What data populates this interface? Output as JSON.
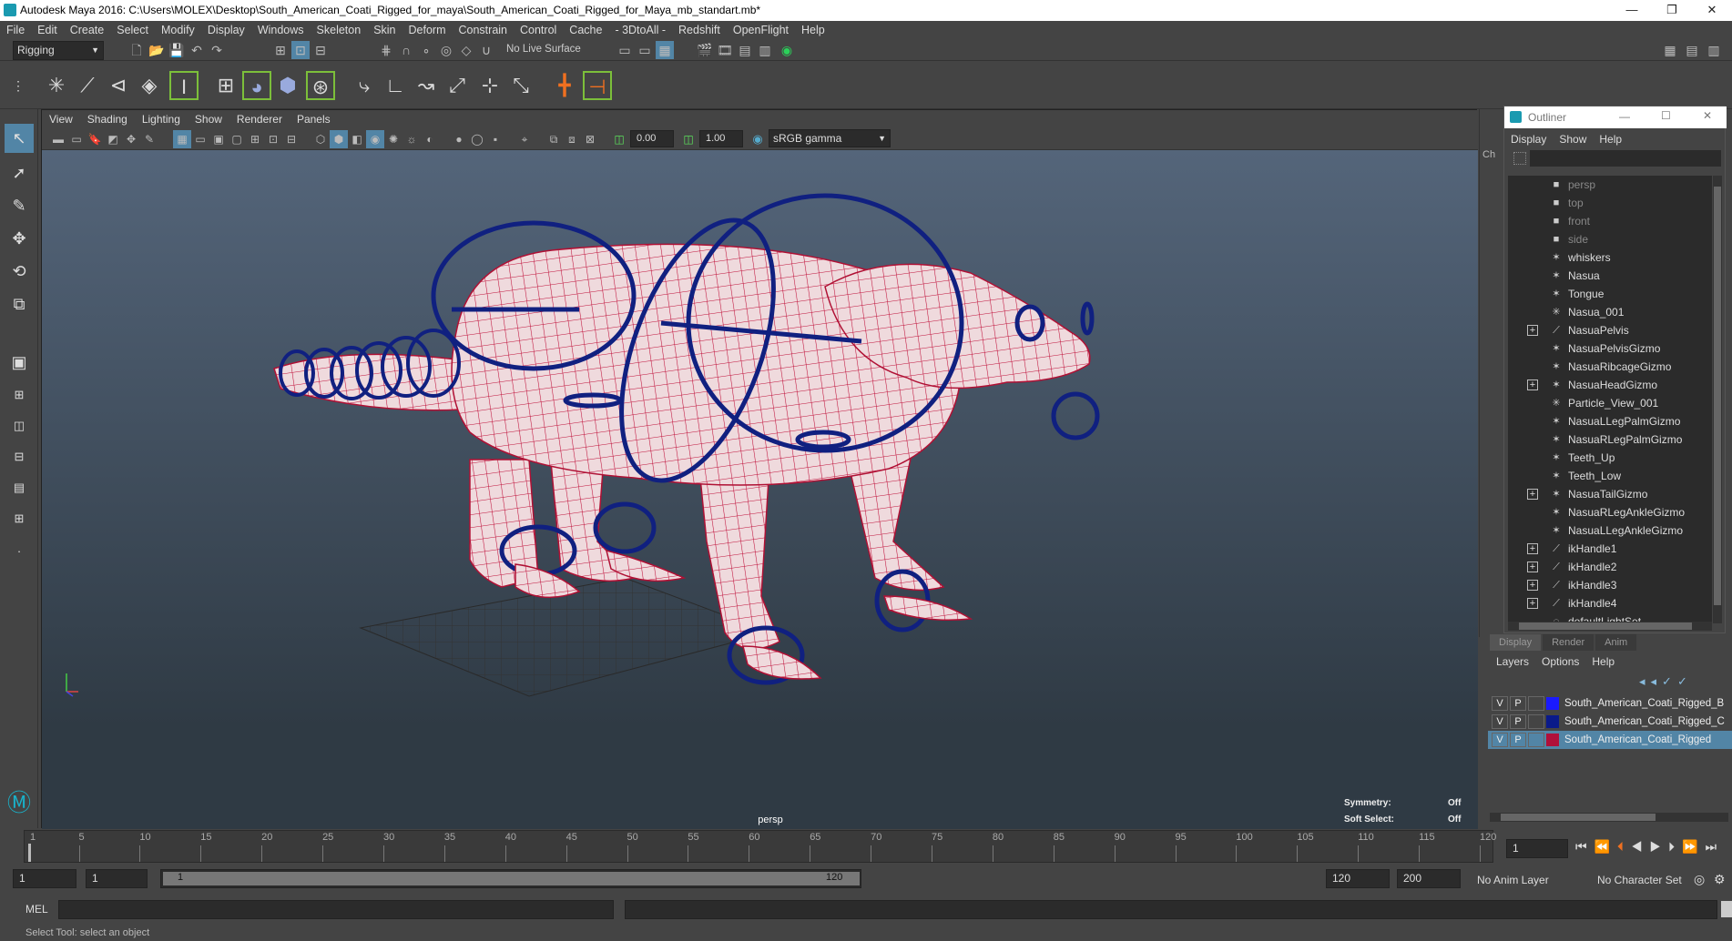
{
  "titlebar": {
    "title": "Autodesk Maya 2016: C:\\Users\\MOLEX\\Desktop\\South_American_Coati_Rigged_for_maya\\South_American_Coati_Rigged_for_Maya_mb_standart.mb*",
    "minimize": "—",
    "restore": "❐",
    "close": "✕"
  },
  "menubar": [
    "File",
    "Edit",
    "Create",
    "Select",
    "Modify",
    "Display",
    "Windows",
    "Skeleton",
    "Skin",
    "Deform",
    "Constrain",
    "Control",
    "Cache",
    "- 3DtoAll -",
    "Redshift",
    "OpenFlight",
    "Help"
  ],
  "statusline": {
    "mode": "Rigging",
    "live_surface": "No Live Surface"
  },
  "viewport": {
    "menu": [
      "View",
      "Shading",
      "Lighting",
      "Show",
      "Renderer",
      "Panels"
    ],
    "near_value": "0.00",
    "far_value": "1.00",
    "color_space": "sRGB gamma",
    "camera_label": "persp",
    "symmetry_label": "Symmetry:",
    "symmetry_value": "Off",
    "soft_select_label": "Soft Select:",
    "soft_select_value": "Off"
  },
  "channel_box_tab": "Ch",
  "outliner": {
    "title": "Outliner",
    "menu": [
      "Display",
      "Show",
      "Help"
    ],
    "items": [
      {
        "label": "persp",
        "icon": "camera-icon",
        "expandable": false,
        "dim": true
      },
      {
        "label": "top",
        "icon": "camera-icon",
        "expandable": false,
        "dim": true
      },
      {
        "label": "front",
        "icon": "camera-icon",
        "expandable": false,
        "dim": true
      },
      {
        "label": "side",
        "icon": "camera-icon",
        "expandable": false,
        "dim": true
      },
      {
        "label": "whiskers",
        "icon": "mesh-icon",
        "expandable": false,
        "dim": false
      },
      {
        "label": "Nasua",
        "icon": "mesh-icon",
        "expandable": false,
        "dim": false
      },
      {
        "label": "Tongue",
        "icon": "mesh-icon",
        "expandable": false,
        "dim": false
      },
      {
        "label": "Nasua_001",
        "icon": "joint-icon",
        "expandable": false,
        "dim": false
      },
      {
        "label": "NasuaPelvis",
        "icon": "bone-icon",
        "expandable": true,
        "dim": false
      },
      {
        "label": "NasuaPelvisGizmo",
        "icon": "mesh-icon",
        "expandable": false,
        "dim": false
      },
      {
        "label": "NasuaRibcageGizmo",
        "icon": "mesh-icon",
        "expandable": false,
        "dim": false
      },
      {
        "label": "NasuaHeadGizmo",
        "icon": "mesh-icon",
        "expandable": true,
        "dim": false
      },
      {
        "label": "Particle_View_001",
        "icon": "joint-icon",
        "expandable": false,
        "dim": false
      },
      {
        "label": "NasuaLLegPalmGizmo",
        "icon": "mesh-icon",
        "expandable": false,
        "dim": false
      },
      {
        "label": "NasuaRLegPalmGizmo",
        "icon": "mesh-icon",
        "expandable": false,
        "dim": false
      },
      {
        "label": "Teeth_Up",
        "icon": "mesh-icon",
        "expandable": false,
        "dim": false
      },
      {
        "label": "Teeth_Low",
        "icon": "mesh-icon",
        "expandable": false,
        "dim": false
      },
      {
        "label": "NasuaTailGizmo",
        "icon": "mesh-icon",
        "expandable": true,
        "dim": false
      },
      {
        "label": "NasuaRLegAnkleGizmo",
        "icon": "mesh-icon",
        "expandable": false,
        "dim": false
      },
      {
        "label": "NasuaLLegAnkleGizmo",
        "icon": "mesh-icon",
        "expandable": false,
        "dim": false
      },
      {
        "label": "ikHandle1",
        "icon": "bone-icon",
        "expandable": true,
        "dim": false
      },
      {
        "label": "ikHandle2",
        "icon": "bone-icon",
        "expandable": true,
        "dim": false
      },
      {
        "label": "ikHandle3",
        "icon": "bone-icon",
        "expandable": true,
        "dim": false
      },
      {
        "label": "ikHandle4",
        "icon": "bone-icon",
        "expandable": true,
        "dim": false
      },
      {
        "label": "defaultLightSet",
        "icon": "set-icon",
        "expandable": false,
        "dim": false
      }
    ]
  },
  "layer_editor": {
    "tabs": [
      "Display",
      "Render",
      "Anim"
    ],
    "menu": [
      "Layers",
      "Options",
      "Help"
    ],
    "layers": [
      {
        "v": "V",
        "p": "P",
        "color": "#1a1aff",
        "name": "South_American_Coati_Rigged_B",
        "selected": false
      },
      {
        "v": "V",
        "p": "P",
        "color": "#0a1a8a",
        "name": "South_American_Coati_Rigged_C",
        "selected": false
      },
      {
        "v": "V",
        "p": "P",
        "color": "#b0103a",
        "name": "South_American_Coati_Rigged",
        "selected": true
      }
    ]
  },
  "timeline": {
    "ticks": [
      "1",
      "5",
      "10",
      "15",
      "20",
      "25",
      "30",
      "35",
      "40",
      "45",
      "50",
      "55",
      "60",
      "65",
      "70",
      "75",
      "80",
      "85",
      "90",
      "95",
      "100",
      "105",
      "110",
      "115",
      "120"
    ],
    "current_frame": "1"
  },
  "range": {
    "start": "1",
    "playback_start": "1",
    "slider_start": "1",
    "slider_end": "120",
    "playback_end": "120",
    "end": "200",
    "anim_layer": "No Anim Layer",
    "character_set": "No Character Set"
  },
  "command": {
    "label": "MEL"
  },
  "help_line": "Select Tool: select an object"
}
